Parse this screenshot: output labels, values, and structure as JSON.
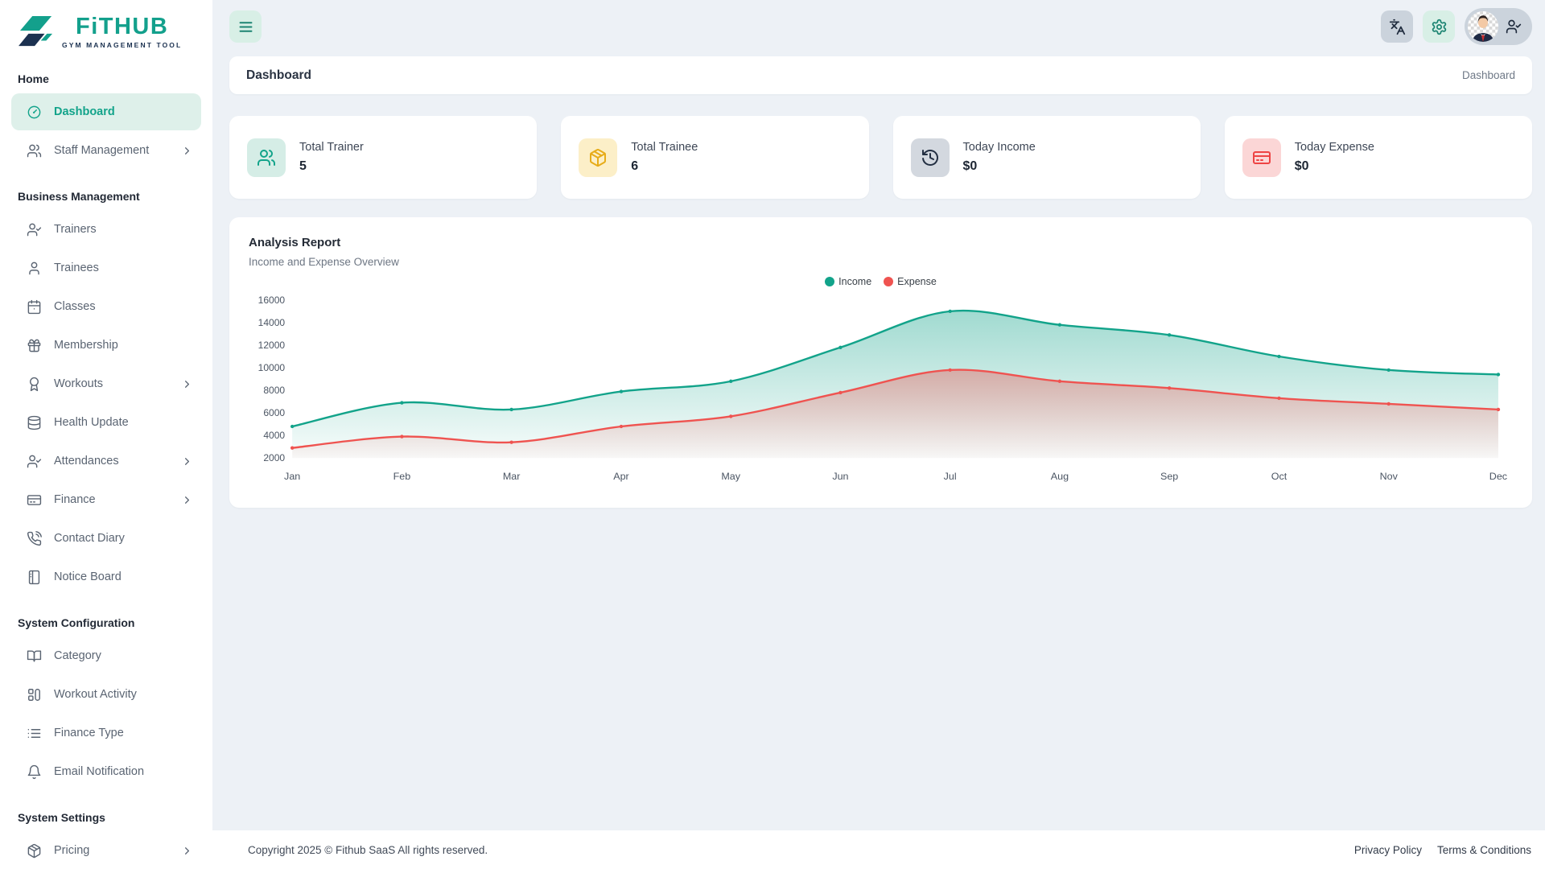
{
  "app": {
    "brand": "FiTHUB",
    "tagline": "GYM MANAGEMENT TOOL",
    "logo_colors": {
      "teal": "#13a08c",
      "navy": "#1b3150"
    }
  },
  "topbar": {
    "menu_icon": "menu",
    "actions": [
      {
        "name": "language",
        "icon": "languages",
        "style": "gray"
      },
      {
        "name": "settings",
        "icon": "settings",
        "style": "mint"
      }
    ],
    "profile": {
      "avatar": "male-avatar",
      "icon": "user-check"
    }
  },
  "sidebar": {
    "sections": [
      {
        "title": "Home",
        "items": [
          {
            "label": "Dashboard",
            "icon": "gauge",
            "active": true
          },
          {
            "label": "Staff Management",
            "icon": "users",
            "chevron": true
          }
        ]
      },
      {
        "title": "Business Management",
        "items": [
          {
            "label": "Trainers",
            "icon": "user-check"
          },
          {
            "label": "Trainees",
            "icon": "user"
          },
          {
            "label": "Classes",
            "icon": "calendar"
          },
          {
            "label": "Membership",
            "icon": "gift"
          },
          {
            "label": "Workouts",
            "icon": "award",
            "chevron": true
          },
          {
            "label": "Health Update",
            "icon": "database"
          },
          {
            "label": "Attendances",
            "icon": "user-check",
            "chevron": true
          },
          {
            "label": "Finance",
            "icon": "credit-card",
            "chevron": true
          },
          {
            "label": "Contact Diary",
            "icon": "phone-call"
          },
          {
            "label": "Notice Board",
            "icon": "notebook"
          }
        ]
      },
      {
        "title": "System Configuration",
        "items": [
          {
            "label": "Category",
            "icon": "book-open"
          },
          {
            "label": "Workout Activity",
            "icon": "panels"
          },
          {
            "label": "Finance Type",
            "icon": "list"
          },
          {
            "label": "Email Notification",
            "icon": "bell"
          }
        ]
      },
      {
        "title": "System Settings",
        "items": [
          {
            "label": "Pricing",
            "icon": "package",
            "chevron": true
          }
        ]
      }
    ]
  },
  "page": {
    "title": "Dashboard",
    "breadcrumb": "Dashboard"
  },
  "stats": {
    "cards": [
      {
        "label": "Total Trainer",
        "value": "5",
        "icon": "users",
        "icon_color": "#12a38a",
        "icon_bg": "#d5ede6"
      },
      {
        "label": "Total Trainee",
        "value": "6",
        "icon": "package",
        "icon_color": "#e7ac19",
        "icon_bg": "#fcefc8"
      },
      {
        "label": "Today Income",
        "value": "$0",
        "icon": "history",
        "icon_color": "#232f42",
        "icon_bg": "#d3d8df"
      },
      {
        "label": "Today Expense",
        "value": "$0",
        "icon": "credit-card",
        "icon_color": "#ee4444",
        "icon_bg": "#fbd6d6"
      }
    ]
  },
  "chart_card": {
    "title": "Analysis Report",
    "subtitle": "Income and Expense Overview"
  },
  "chart_data": {
    "type": "area",
    "title": "Analysis Report",
    "subtitle": "Income and Expense Overview",
    "categories": [
      "Jan",
      "Feb",
      "Mar",
      "Apr",
      "May",
      "Jun",
      "Jul",
      "Aug",
      "Sep",
      "Oct",
      "Nov",
      "Dec"
    ],
    "series": [
      {
        "name": "Income",
        "color": "#12a38a",
        "values": [
          4800,
          6900,
          6300,
          7900,
          8800,
          11800,
          15000,
          13800,
          12900,
          11000,
          9800,
          9400
        ]
      },
      {
        "name": "Expense",
        "color": "#ef5350",
        "values": [
          2900,
          3900,
          3400,
          4800,
          5700,
          7800,
          9800,
          8800,
          8200,
          7300,
          6800,
          6300
        ]
      }
    ],
    "ylim": [
      2000,
      16000
    ],
    "ytick_step": 2000,
    "grid": false,
    "legend_position": "top",
    "smooth": true,
    "gradient_fill": true
  },
  "footer": {
    "copyright": "Copyright 2025 © Fithub SaaS All rights reserved.",
    "links": [
      "Privacy Policy",
      "Terms & Conditions"
    ]
  }
}
